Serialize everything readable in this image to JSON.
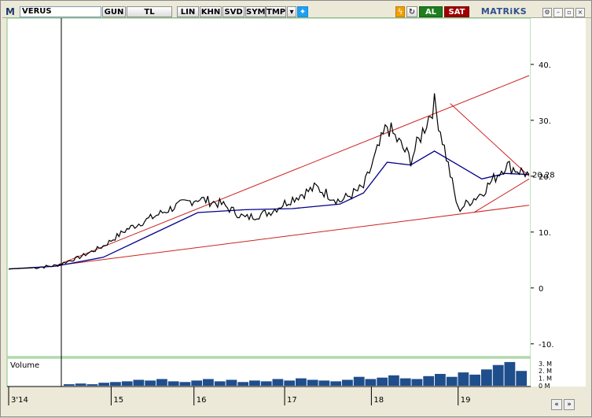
{
  "toolbar": {
    "logo": "M",
    "symbol": "VERUS",
    "period": "GUN",
    "currency": "TL",
    "scale_lin": "LIN",
    "khn": "KHN",
    "svd": "SVD",
    "sym": "SYM",
    "tmp": "TMP",
    "buy_label": "AL",
    "sell_label": "SAT",
    "brand": "MATRiKS"
  },
  "chart_data": {
    "type": "line",
    "title": "",
    "ylim": [
      -12,
      48
    ],
    "yticks": [
      40,
      30,
      20,
      10,
      0,
      -10
    ],
    "ytick_labels": [
      "40.",
      "30.",
      "20.",
      "10.",
      "0",
      "-10."
    ],
    "last_value_label": "20.28",
    "x_labels": [
      "3'14",
      "15",
      "16",
      "17",
      "18",
      "19"
    ],
    "price_series": {
      "name": "",
      "x": [
        0,
        3,
        6,
        9,
        12,
        15,
        18,
        21,
        24,
        27,
        30,
        33,
        36,
        39,
        42,
        45,
        48,
        51,
        54,
        57,
        60,
        63,
        66
      ],
      "y": [
        3.4,
        3.6,
        4.0,
        5.5,
        7.5,
        10.5,
        12.5,
        14.5,
        16.0,
        15.0,
        12.5,
        13.5,
        16.0,
        18.0,
        15.5,
        18.0,
        29.0,
        23.0,
        33.0,
        14.0,
        17.0,
        22.0,
        20.3
      ]
    },
    "ma_series": {
      "name": "",
      "x": [
        0,
        6,
        12,
        18,
        24,
        30,
        36,
        42,
        45,
        48,
        51,
        54,
        57,
        60,
        63,
        66
      ],
      "y": [
        3.4,
        3.9,
        5.5,
        9.5,
        13.5,
        14.0,
        14.2,
        15.0,
        17.0,
        22.5,
        22.0,
        24.5,
        22.0,
        19.5,
        20.5,
        20.3
      ]
    },
    "trend_lines": [
      {
        "from": [
          6,
          4.0
        ],
        "to": [
          66,
          38.0
        ]
      },
      {
        "from": [
          6,
          4.0
        ],
        "to": [
          66,
          14.8
        ]
      },
      {
        "from": [
          56,
          33.0
        ],
        "to": [
          66,
          20.0
        ]
      },
      {
        "from": [
          59,
          13.5
        ],
        "to": [
          66,
          19.5
        ]
      }
    ],
    "volume": {
      "label": "Volume",
      "ytick_labels": [
        "3.",
        "2.",
        "1.",
        "0"
      ],
      "unit": "M",
      "values": [
        0.2,
        0.3,
        0.2,
        0.4,
        0.5,
        0.6,
        0.8,
        0.7,
        0.9,
        0.6,
        0.5,
        0.7,
        0.9,
        0.6,
        0.8,
        0.5,
        0.7,
        0.6,
        0.9,
        0.7,
        1.0,
        0.8,
        0.7,
        0.6,
        0.8,
        1.2,
        0.9,
        1.1,
        1.4,
        1.0,
        0.9,
        1.3,
        1.6,
        1.2,
        1.8,
        1.5,
        2.2,
        2.8,
        3.2,
        2.0
      ]
    }
  },
  "controls": {
    "nav_left": "«",
    "nav_right": "»"
  }
}
